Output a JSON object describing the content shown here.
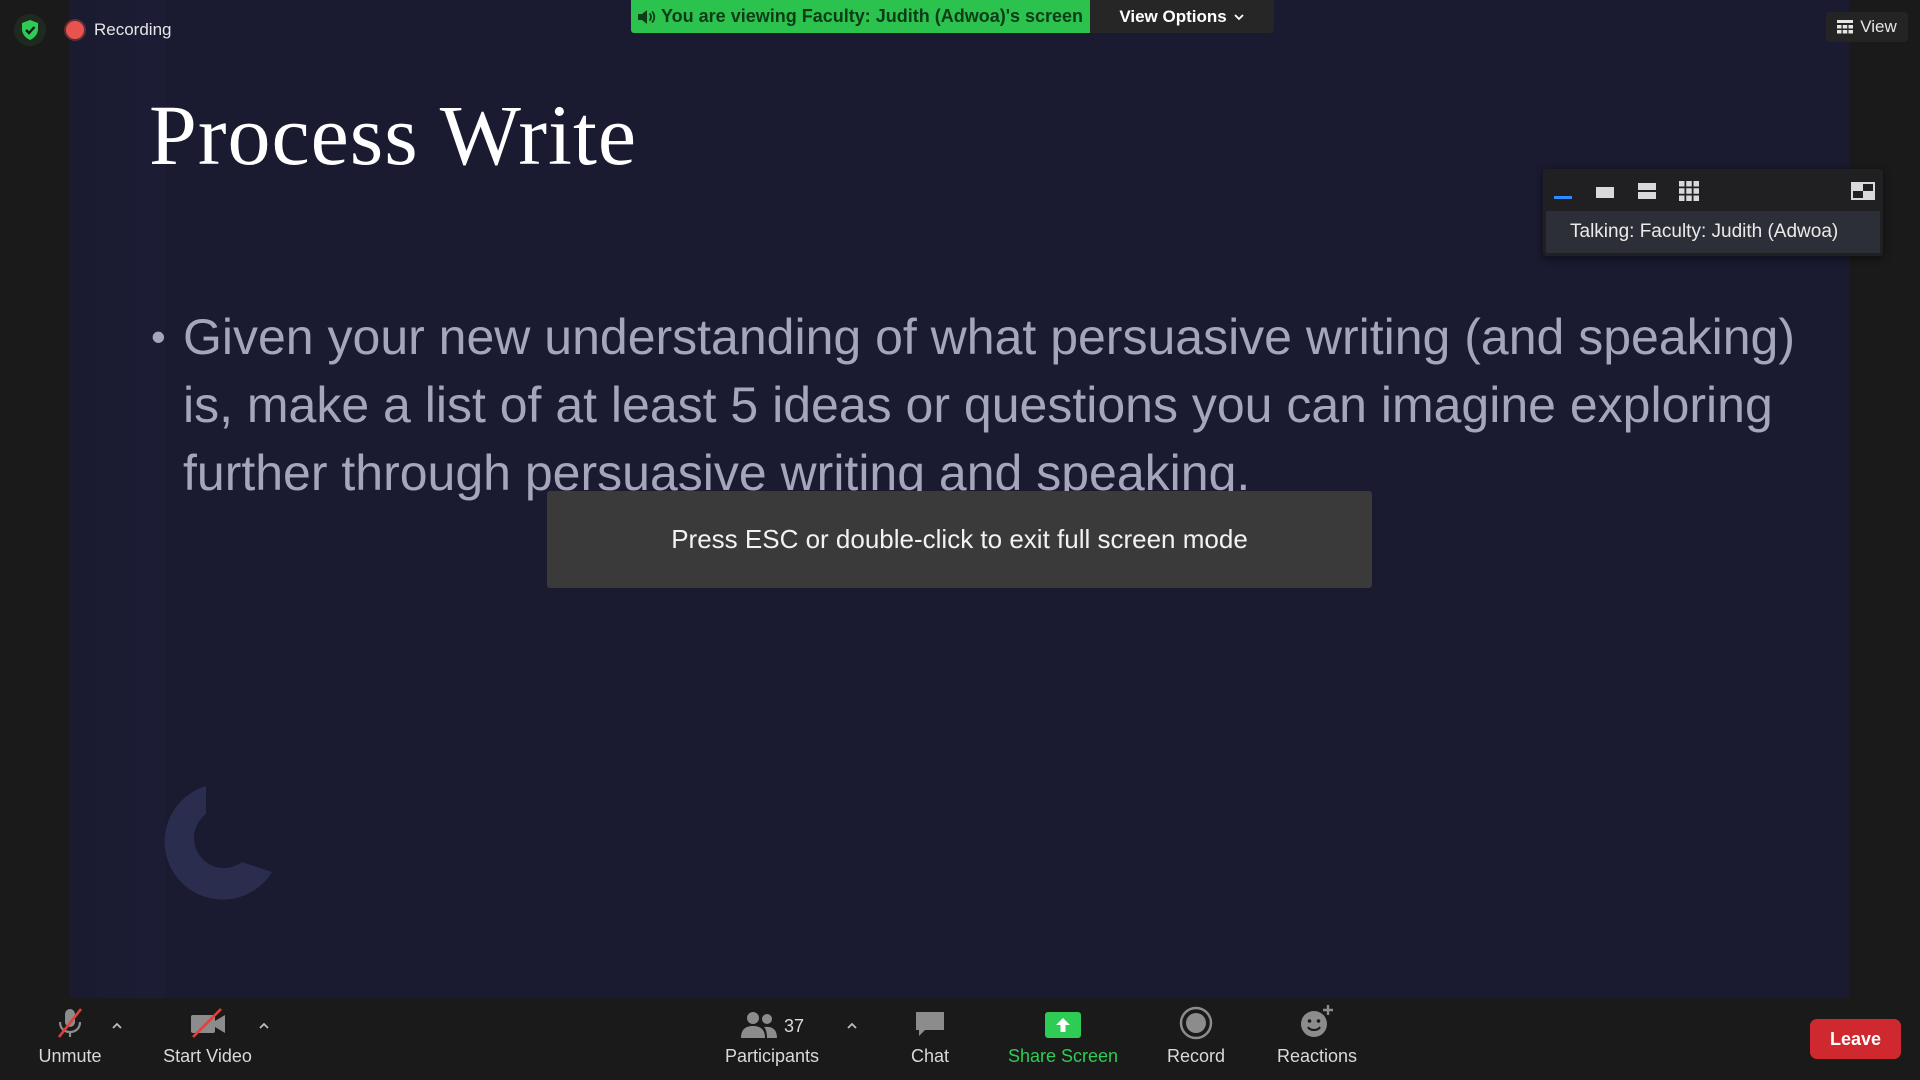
{
  "status": {
    "recording_label": "Recording"
  },
  "banner": {
    "text": "You are viewing Faculty: Judith (Adwoa)'s screen",
    "view_options_label": "View Options"
  },
  "view_button": {
    "label": "View"
  },
  "speaker_panel": {
    "talking_label": "Talking: Faculty: Judith (Adwoa)",
    "layout_icons": [
      "minimize-icon",
      "speaker-view-icon",
      "side-by-side-icon",
      "gallery-view-icon",
      "pip-icon"
    ]
  },
  "slide": {
    "title": "Process Write",
    "bullets": [
      "Given your new understanding of what persuasive writing (and speaking) is, make a list of at least 5 ideas or questions you can imagine exploring further through persuasive writing and speaking."
    ]
  },
  "overlay": {
    "esc_message": "Press ESC or double-click to exit full screen mode"
  },
  "toolbar": {
    "unmute_label": "Unmute",
    "start_video_label": "Start Video",
    "participants_label": "Participants",
    "participants_count": "37",
    "chat_label": "Chat",
    "share_screen_label": "Share Screen",
    "record_label": "Record",
    "reactions_label": "Reactions",
    "leave_label": "Leave"
  },
  "colors": {
    "banner_green": "#2cc24e",
    "slide_bg": "#1a1a30",
    "leave_red": "#d0282f",
    "share_green": "#2ecc55"
  }
}
